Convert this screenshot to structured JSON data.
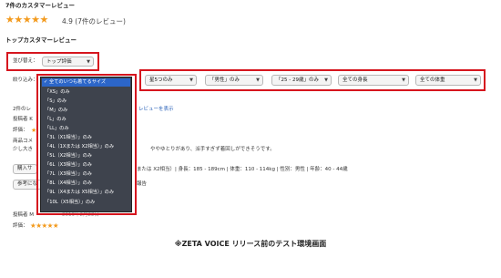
{
  "summary": {
    "title": "7件のカスタマーレビュー",
    "stars": "★★★★★",
    "rating_text": "4.9 (7件のレビュー)"
  },
  "top_reviews_title": "トップカスタマーレビュー",
  "sort": {
    "label": "並び替え：",
    "selected": "トップ評価"
  },
  "filter": {
    "label": "絞り込み：",
    "star_filter": "星5つのみ",
    "gender_filter": "「男性」のみ",
    "age_filter": "「25 - 29歳」のみ",
    "height_filter": "全ての身長",
    "weight_filter": "全ての体重",
    "size_options": [
      "全てのいつも着てるサイズ",
      "「XS」のみ",
      "「S」のみ",
      "「M」のみ",
      "「L」のみ",
      "「LL」のみ",
      "「3L（X1相当）」のみ",
      "「4L（1Xまたは X2相当）」のみ",
      "「5L（X2相当）」のみ",
      "「6L（X3相当）」のみ",
      "「7L（X3相当）」のみ",
      "「8L（X4相当）」のみ",
      "「9L（X4または X5相当）」のみ",
      "「10L（X5相当）」のみ"
    ],
    "selected_mark": "✓"
  },
  "review1": {
    "count_prefix": "2件のレ",
    "reset_link": "レビューを表示",
    "poster_prefix": "投稿者 K",
    "rating_prefix": "評価：",
    "stars": "★",
    "product_comment_prefix": "商品コメ",
    "text_start": "少し大き",
    "text_end": "ややゆとりがあり、派手すぎず着回しができそうです。",
    "purchase_button": "購入サ",
    "purchase_info": "または X2相当）| 身長：185 - 189cm | 体重：110 - 114kg | 性別：男性 | 年齢：40 - 44歳",
    "helpful_button": "参考にな",
    "report_link": "報告"
  },
  "review2": {
    "poster": "投稿者 M",
    "poster_suffix": "2019年2月22日",
    "rating_prefix": "評価：",
    "stars": "★★★★★"
  },
  "footer_caption": "※ZETA VOICE リリース前のテスト環境画面",
  "colors": {
    "star": "#f39a1d",
    "highlight_border": "#d6151e",
    "dropdown_bg": "#3e434d",
    "dropdown_selected": "#2c66c9",
    "link": "#2a62b8"
  }
}
